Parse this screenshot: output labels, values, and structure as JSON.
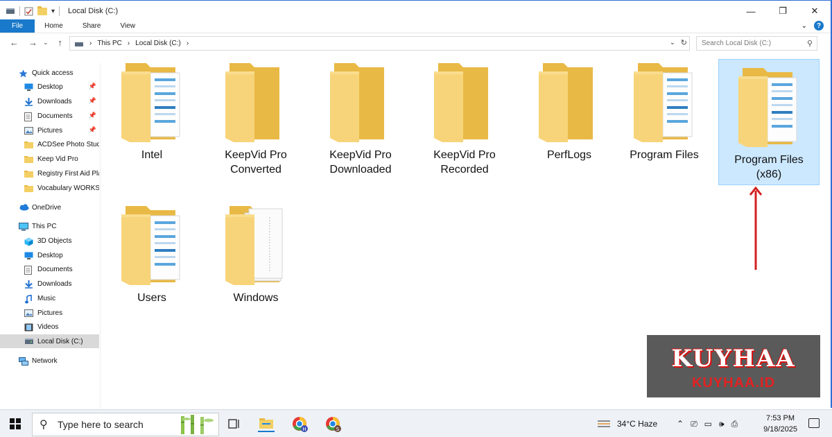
{
  "window": {
    "title": "Local Disk (C:)",
    "controls": {
      "minimize": "—",
      "restore": "❐",
      "close": "✕"
    }
  },
  "ribbon": {
    "tabs": [
      "File",
      "Home",
      "Share",
      "View"
    ],
    "expand": "⌄"
  },
  "address": {
    "path": [
      "This PC",
      "Local Disk (C:)"
    ],
    "separator": "›",
    "search_placeholder": "Search Local Disk (C:)"
  },
  "sidebar": {
    "items": [
      {
        "label": "Quick access",
        "icon": "star-icon",
        "level": 0,
        "pinned": false
      },
      {
        "label": "Desktop",
        "icon": "desktop-icon",
        "level": 1,
        "pinned": true
      },
      {
        "label": "Downloads",
        "icon": "download-arrow-icon",
        "level": 1,
        "pinned": true
      },
      {
        "label": "Documents",
        "icon": "document-icon",
        "level": 1,
        "pinned": true
      },
      {
        "label": "Pictures",
        "icon": "pictures-icon",
        "level": 1,
        "pinned": true
      },
      {
        "label": "ACDSee Photo Stud",
        "icon": "folder-icon",
        "level": 1,
        "pinned": false
      },
      {
        "label": "Keep Vid Pro",
        "icon": "folder-icon",
        "level": 1,
        "pinned": false
      },
      {
        "label": "Registry First Aid Pla",
        "icon": "folder-icon",
        "level": 1,
        "pinned": false
      },
      {
        "label": "Vocabulary WORKSI",
        "icon": "folder-icon",
        "level": 1,
        "pinned": false
      },
      {
        "label": "OneDrive",
        "icon": "cloud-icon",
        "level": 0,
        "pinned": false
      },
      {
        "label": "This PC",
        "icon": "computer-icon",
        "level": 0,
        "pinned": false
      },
      {
        "label": "3D Objects",
        "icon": "cube-icon",
        "level": 1,
        "pinned": false
      },
      {
        "label": "Desktop",
        "icon": "desktop-icon",
        "level": 1,
        "pinned": false
      },
      {
        "label": "Documents",
        "icon": "document-icon",
        "level": 1,
        "pinned": false
      },
      {
        "label": "Downloads",
        "icon": "download-arrow-icon",
        "level": 1,
        "pinned": false
      },
      {
        "label": "Music",
        "icon": "music-note-icon",
        "level": 1,
        "pinned": false
      },
      {
        "label": "Pictures",
        "icon": "pictures-icon",
        "level": 1,
        "pinned": false
      },
      {
        "label": "Videos",
        "icon": "film-icon",
        "level": 1,
        "pinned": false
      },
      {
        "label": "Local Disk (C:)",
        "icon": "drive-icon",
        "level": 1,
        "pinned": false,
        "selected": true
      },
      {
        "label": "Network",
        "icon": "network-icon",
        "level": 0,
        "pinned": false
      }
    ]
  },
  "folders": [
    {
      "label_lines": [
        "Intel"
      ],
      "kind": "docs",
      "selected": false
    },
    {
      "label_lines": [
        "KeepVid Pro",
        "Converted"
      ],
      "kind": "plain",
      "selected": false
    },
    {
      "label_lines": [
        "KeepVid Pro",
        "Downloaded"
      ],
      "kind": "plain",
      "selected": false
    },
    {
      "label_lines": [
        "KeepVid Pro",
        "Recorded"
      ],
      "kind": "plain",
      "selected": false
    },
    {
      "label_lines": [
        "PerfLogs"
      ],
      "kind": "plain",
      "selected": false
    },
    {
      "label_lines": [
        "Program Files"
      ],
      "kind": "docs",
      "selected": false
    },
    {
      "label_lines": [
        "Program Files",
        "(x86)"
      ],
      "kind": "docs",
      "selected": true
    },
    {
      "label_lines": [
        "Users"
      ],
      "kind": "docs",
      "selected": false
    },
    {
      "label_lines": [
        "Windows"
      ],
      "kind": "paper",
      "selected": false
    }
  ],
  "watermark": {
    "big": "KUYHAA",
    "small": "KUYHAA.ID"
  },
  "colors": {
    "accent": "#1979ca",
    "selection": "#cce8ff",
    "folder": "#f3cf64",
    "arrow": "#d42020"
  },
  "taskbar": {
    "search_placeholder": "Type here to search",
    "weather": "34°C  Haze",
    "time": "7:53 PM",
    "date": "9/18/2025",
    "chrome_badges": [
      "H",
      "S"
    ]
  }
}
